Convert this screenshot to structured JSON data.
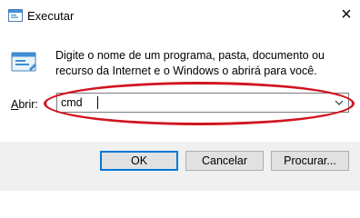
{
  "window": {
    "title": "Executar",
    "close_symbol": "×"
  },
  "content": {
    "description_line1": "Digite o nome de um programa, pasta, documento ou",
    "description_line2": "recurso da Internet e o Windows o abrirá para você.",
    "open_label": "Abrir:",
    "input_value": "cmd"
  },
  "buttons": {
    "ok": "OK",
    "cancel": "Cancelar",
    "browse": "Procurar..."
  },
  "colors": {
    "highlight": "#d01521",
    "accent": "#0078d7"
  },
  "icons": {
    "title": "run-icon",
    "app": "run-app-icon",
    "dropdown": "chevron-down-icon"
  }
}
